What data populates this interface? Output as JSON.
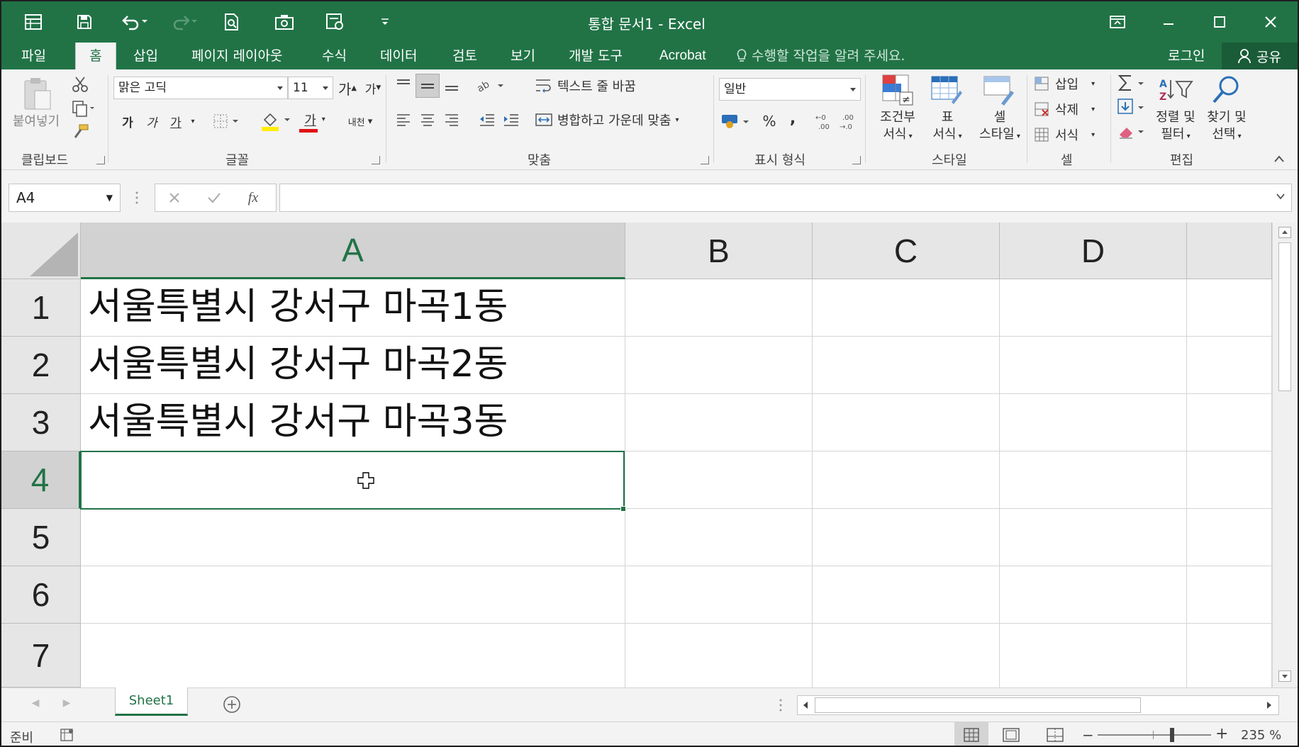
{
  "window": {
    "title": "통합 문서1 - Excel",
    "accent": "#217346"
  },
  "tabs": [
    {
      "label": "파일"
    },
    {
      "label": "홈",
      "active": true
    },
    {
      "label": "삽입"
    },
    {
      "label": "페이지 레이아웃"
    },
    {
      "label": "수식"
    },
    {
      "label": "데이터"
    },
    {
      "label": "검토"
    },
    {
      "label": "보기"
    },
    {
      "label": "개발 도구"
    },
    {
      "label": "Acrobat"
    }
  ],
  "tell_me": "수행할 작업을 알려 주세요.",
  "login": "로그인",
  "share": "공유",
  "ribbon": {
    "clipboard": {
      "paste": "붙여넣기",
      "label": "클립보드"
    },
    "font": {
      "name": "맑은 고딕",
      "size": "11",
      "bold": "가",
      "italic": "가",
      "underline": "가",
      "font_color_sample": "가",
      "label": "글꼴",
      "phonetic": "내천"
    },
    "alignment": {
      "wrap": "텍스트 줄 바꿈",
      "merge": "병합하고 가운데 맞춤",
      "label": "맞춤"
    },
    "number": {
      "format": "일반",
      "percent": "%",
      "comma": ",",
      "label": "표시 형식"
    },
    "styles": {
      "conditional_1": "조건부",
      "conditional_2": "서식",
      "table_1": "표",
      "table_2": "서식",
      "cell_1": "셀",
      "cell_2": "스타일",
      "label": "스타일"
    },
    "cells": {
      "insert": "삽입",
      "delete": "삭제",
      "format": "서식",
      "label": "셀"
    },
    "editing": {
      "sort_1": "정렬 및",
      "sort_2": "필터",
      "find_1": "찾기 및",
      "find_2": "선택",
      "label": "편집"
    }
  },
  "formula_bar": {
    "name_box": "A4",
    "formula": "",
    "fx": "fx"
  },
  "sheet": {
    "columns": [
      "A",
      "B",
      "C",
      "D"
    ],
    "selected_column": "A",
    "rows": [
      "1",
      "2",
      "3",
      "4",
      "5",
      "6",
      "7"
    ],
    "selected_row": "4",
    "cells": {
      "A1": "서울특별시 강서구 마곡1동",
      "A2": "서울특별시 강서구 마곡2동",
      "A3": "서울특별시 강서구 마곡3동"
    },
    "active_cell": "A4"
  },
  "sheet_tabs": [
    "Sheet1"
  ],
  "status": {
    "ready": "준비",
    "zoom": "235 %"
  }
}
